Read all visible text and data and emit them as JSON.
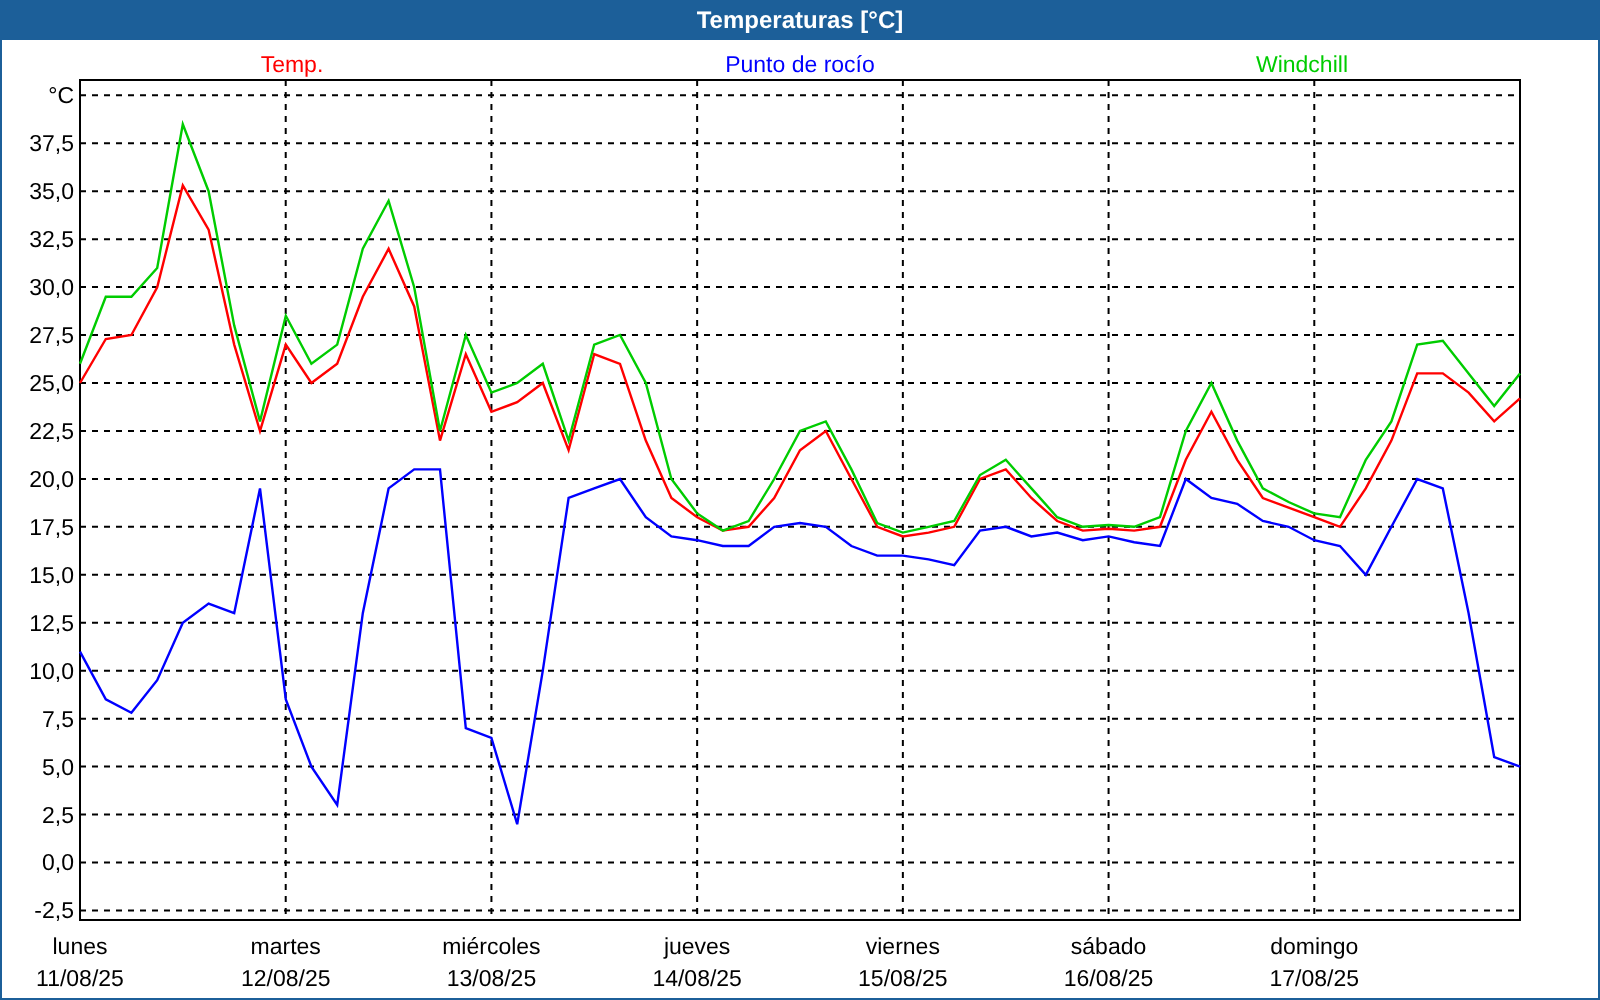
{
  "window": {
    "title": "Temperaturas [°C]"
  },
  "chart": {
    "chart_data": {
      "type": "line",
      "categories": [
        "lunes",
        null,
        null,
        null,
        null,
        null,
        null,
        null,
        "martes",
        null,
        null,
        null,
        null,
        null,
        null,
        null,
        "miércoles",
        null,
        null,
        null,
        null,
        null,
        null,
        null,
        "jueves",
        null,
        null,
        null,
        null,
        null,
        null,
        null,
        "viernes",
        null,
        null,
        null,
        null,
        null,
        null,
        null,
        "sábado",
        null,
        null,
        null,
        null,
        null,
        null,
        null,
        "domingo",
        null,
        null,
        null,
        null,
        null,
        null,
        null,
        null
      ],
      "series": [
        {
          "name": "Temp.",
          "color": "#ff0000",
          "values": [
            25,
            27.3,
            27.5,
            30,
            35.3,
            33,
            27,
            22.5,
            27,
            25,
            26,
            29.5,
            32,
            29,
            22,
            26.5,
            23.5,
            24,
            25,
            21.5,
            26.5,
            26,
            22,
            19,
            18,
            17.3,
            17.5,
            19,
            21.5,
            22.5,
            20,
            17.5,
            17,
            17.2,
            17.5,
            20,
            20.5,
            19,
            17.8,
            17.3,
            17.4,
            17.3,
            17.5,
            21,
            23.5,
            21,
            19,
            18.5,
            18,
            17.5,
            19.5,
            22,
            25.5,
            25.5,
            24.5,
            23,
            24.2
          ]
        },
        {
          "name": "Punto de rocío",
          "color": "#0000ff",
          "values": [
            11,
            8.5,
            7.8,
            9.5,
            12.5,
            13.5,
            13,
            19.5,
            8.5,
            5,
            3,
            13,
            19.5,
            20.5,
            20.5,
            7,
            6.5,
            2,
            10,
            19,
            19.5,
            20,
            18,
            17,
            16.8,
            16.5,
            16.5,
            17.5,
            17.7,
            17.5,
            16.5,
            16,
            16,
            15.8,
            15.5,
            17.3,
            17.5,
            17,
            17.2,
            16.8,
            17,
            16.7,
            16.5,
            20,
            19,
            18.7,
            17.8,
            17.5,
            16.8,
            16.5,
            15,
            17.5,
            20,
            19.5,
            13,
            5.5,
            5
          ]
        },
        {
          "name": "Windchill",
          "color": "#00cc00",
          "values": [
            26,
            29.5,
            29.5,
            31,
            38.5,
            35,
            28,
            23,
            28.5,
            26,
            27,
            32,
            34.5,
            30,
            22.5,
            27.5,
            24.5,
            25,
            26,
            22,
            27,
            27.5,
            25,
            20,
            18.2,
            17.3,
            17.8,
            20,
            22.5,
            23,
            20.5,
            17.7,
            17.2,
            17.5,
            17.8,
            20.2,
            21,
            19.5,
            18,
            17.5,
            17.6,
            17.5,
            18,
            22.5,
            25,
            22,
            19.5,
            18.8,
            18.2,
            18,
            21,
            23,
            27,
            27.2,
            25.5,
            23.8,
            25.5
          ]
        }
      ],
      "ylim": [
        -3,
        40.8
      ],
      "grid": true,
      "yticks": [
        {
          "value": 40,
          "label": "°C"
        },
        {
          "value": 37.5,
          "label": "37,5"
        },
        {
          "value": 35,
          "label": "35,0"
        },
        {
          "value": 32.5,
          "label": "32,5"
        },
        {
          "value": 30,
          "label": "30,0"
        },
        {
          "value": 27.5,
          "label": "27,5"
        },
        {
          "value": 25,
          "label": "25,0"
        },
        {
          "value": 22.5,
          "label": "22,5"
        },
        {
          "value": 20,
          "label": "20,0"
        },
        {
          "value": 17.5,
          "label": "17,5"
        },
        {
          "value": 15,
          "label": "15,0"
        },
        {
          "value": 12.5,
          "label": "12,5"
        },
        {
          "value": 10,
          "label": "10,0"
        },
        {
          "value": 7.5,
          "label": "7,5"
        },
        {
          "value": 5,
          "label": "5,0"
        },
        {
          "value": 2.5,
          "label": "2,5"
        },
        {
          "value": 0,
          "label": "0,0"
        },
        {
          "value": -2.5,
          "label": "-2,5"
        }
      ]
    },
    "x_dates": [
      "11/08/25",
      "12/08/25",
      "13/08/25",
      "14/08/25",
      "15/08/25",
      "16/08/25",
      "17/08/25"
    ]
  }
}
